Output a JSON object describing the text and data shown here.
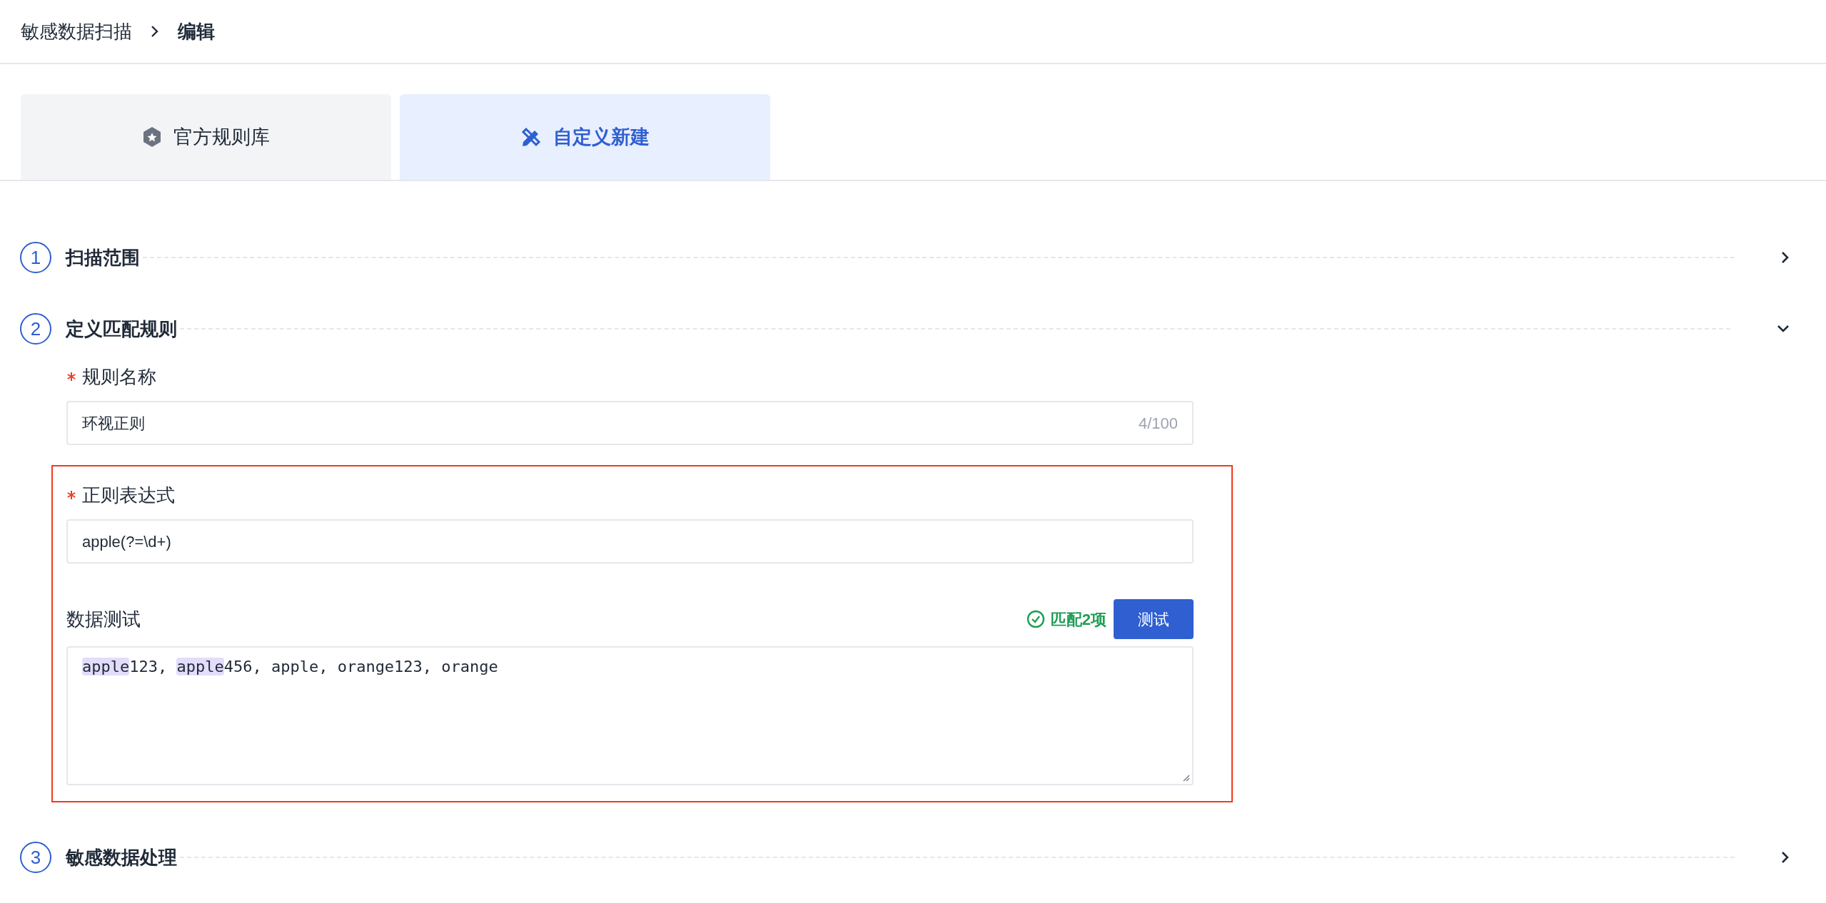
{
  "breadcrumb": [
    {
      "label": "敏感数据扫描",
      "current": false
    },
    {
      "label": "编辑",
      "current": true
    }
  ],
  "tabs": [
    {
      "label": "官方规则库",
      "selected": false,
      "kind": "library"
    },
    {
      "label": "自定义新建",
      "selected": true,
      "kind": "custom"
    }
  ],
  "steps": [
    {
      "number": "1",
      "title": "扫描范围",
      "expanded": false
    },
    {
      "number": "2",
      "title": "定义匹配规则",
      "expanded": true
    },
    {
      "number": "3",
      "title": "敏感数据处理",
      "expanded": false
    }
  ],
  "rule_form": {
    "name_field": {
      "label": "规则名称",
      "required": true,
      "value": "环视正则",
      "counter": "4/100"
    },
    "regex_field": {
      "label": "正则表达式",
      "required": true,
      "value": "apple(?=\\d+)"
    },
    "test": {
      "label": "数据测试",
      "match_status": "匹配2项",
      "button": "测试",
      "segments": [
        {
          "text": "apple",
          "matched": true
        },
        {
          "text": "123, ",
          "matched": false
        },
        {
          "text": "apple",
          "matched": true
        },
        {
          "text": "456, apple, orange123, orange",
          "matched": false
        }
      ]
    }
  }
}
